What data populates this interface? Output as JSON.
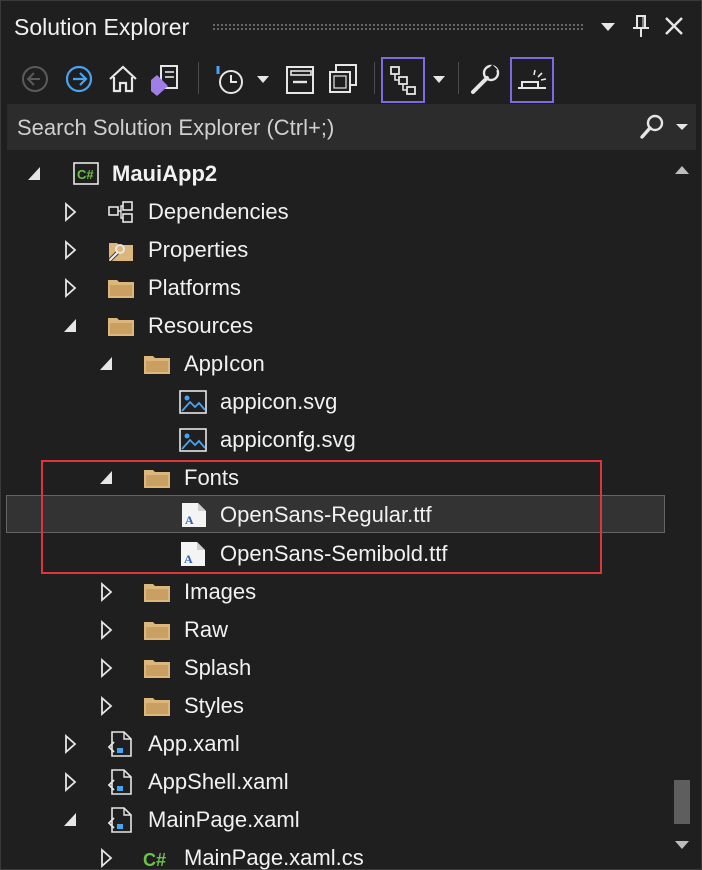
{
  "window": {
    "title": "Solution Explorer"
  },
  "search": {
    "placeholder": "Search Solution Explorer (Ctrl+;)"
  },
  "tree": {
    "items": [
      {
        "label": "MauiApp2",
        "icon": "csharp-project-icon",
        "expanded": true
      },
      {
        "label": "Dependencies",
        "icon": "dependencies-icon",
        "expanded": false
      },
      {
        "label": "Properties",
        "icon": "properties-folder-icon",
        "expanded": false
      },
      {
        "label": "Platforms",
        "icon": "folder-icon",
        "expanded": false
      },
      {
        "label": "Resources",
        "icon": "folder-icon",
        "expanded": true
      },
      {
        "label": "AppIcon",
        "icon": "folder-icon",
        "expanded": true
      },
      {
        "label": "appicon.svg",
        "icon": "image-file-icon"
      },
      {
        "label": "appiconfg.svg",
        "icon": "image-file-icon"
      },
      {
        "label": "Fonts",
        "icon": "folder-icon",
        "expanded": true
      },
      {
        "label": "OpenSans-Regular.ttf",
        "icon": "font-file-icon",
        "selected": true
      },
      {
        "label": "OpenSans-Semibold.ttf",
        "icon": "font-file-icon"
      },
      {
        "label": "Images",
        "icon": "folder-icon",
        "expanded": false
      },
      {
        "label": "Raw",
        "icon": "folder-icon",
        "expanded": false
      },
      {
        "label": "Splash",
        "icon": "folder-icon",
        "expanded": false
      },
      {
        "label": "Styles",
        "icon": "folder-icon",
        "expanded": false
      },
      {
        "label": "App.xaml",
        "icon": "xaml-file-icon",
        "expanded": false
      },
      {
        "label": "AppShell.xaml",
        "icon": "xaml-file-icon",
        "expanded": false
      },
      {
        "label": "MainPage.xaml",
        "icon": "xaml-file-icon",
        "expanded": true
      },
      {
        "label": "MainPage.xaml.cs",
        "icon": "csharp-file-icon",
        "expanded": false
      }
    ]
  },
  "colors": {
    "background": "#1f1f1f",
    "accent": "#7b6ce4",
    "highlight_border": "#e0343b",
    "folder": "#dcb67a"
  }
}
